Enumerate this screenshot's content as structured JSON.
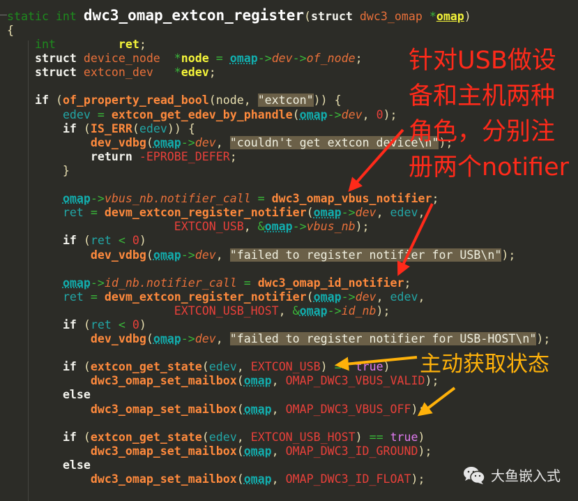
{
  "colors": {
    "background": "#2c2c27",
    "annotation_red": "#ff2a1a",
    "annotation_orange": "#ffb20a"
  },
  "code_lines": [
    [
      [
        "t",
        "static int "
      ],
      [
        "h",
        "dwc3_omap_extcon_register"
      ],
      [
        "p",
        "("
      ],
      [
        "k",
        "struct "
      ],
      [
        "s",
        "dwc3_omap "
      ],
      [
        "g",
        "*"
      ],
      [
        "vu",
        "omap"
      ],
      [
        "p",
        ")"
      ]
    ],
    [
      [
        "p",
        "{"
      ]
    ],
    [
      [
        "p",
        "    "
      ],
      [
        "t",
        "int"
      ],
      [
        "p",
        "         "
      ],
      [
        "v",
        "ret"
      ],
      [
        "p",
        ";"
      ]
    ],
    [
      [
        "p",
        "    "
      ],
      [
        "k",
        "struct "
      ],
      [
        "s",
        "device_node  "
      ],
      [
        "g",
        "*"
      ],
      [
        "v",
        "node"
      ],
      [
        "g",
        " = "
      ],
      [
        "o",
        "omap"
      ],
      [
        "g",
        "->"
      ],
      [
        "m",
        "dev"
      ],
      [
        "g",
        "->"
      ],
      [
        "m",
        "of_node"
      ],
      [
        "p",
        ";"
      ]
    ],
    [
      [
        "p",
        "    "
      ],
      [
        "k",
        "struct "
      ],
      [
        "s",
        "extcon_dev   "
      ],
      [
        "g",
        "*"
      ],
      [
        "v",
        "edev"
      ],
      [
        "p",
        ";"
      ]
    ],
    [],
    [
      [
        "p",
        "    "
      ],
      [
        "k",
        "if "
      ],
      [
        "p",
        "("
      ],
      [
        "f",
        "of_property_read_bool"
      ],
      [
        "p",
        "(node, "
      ],
      [
        "q",
        "\"extcon\""
      ],
      [
        "p",
        ")) {"
      ]
    ],
    [
      [
        "p",
        "        "
      ],
      [
        "r",
        "edev"
      ],
      [
        "g",
        " = "
      ],
      [
        "f",
        "extcon_get_edev_by_phandle"
      ],
      [
        "p",
        "("
      ],
      [
        "o",
        "omap"
      ],
      [
        "g",
        "->"
      ],
      [
        "m",
        "dev"
      ],
      [
        "p",
        ", "
      ],
      [
        "n",
        "0"
      ],
      [
        "p",
        ");"
      ]
    ],
    [
      [
        "p",
        "        "
      ],
      [
        "k",
        "if "
      ],
      [
        "p",
        "("
      ],
      [
        "f",
        "IS_ERR"
      ],
      [
        "p",
        "("
      ],
      [
        "r",
        "edev"
      ],
      [
        "p",
        ")) {"
      ]
    ],
    [
      [
        "p",
        "            "
      ],
      [
        "f",
        "dev_vdbg"
      ],
      [
        "p",
        "("
      ],
      [
        "o",
        "omap"
      ],
      [
        "g",
        "->"
      ],
      [
        "m",
        "dev"
      ],
      [
        "p",
        ", "
      ],
      [
        "q",
        "\"couldn't get extcon device\\n\""
      ],
      [
        "p",
        ");"
      ]
    ],
    [
      [
        "p",
        "            "
      ],
      [
        "k",
        "return "
      ],
      [
        "c",
        "-EPROBE_DEFER"
      ],
      [
        "p",
        ";"
      ]
    ],
    [
      [
        "p",
        "        }"
      ]
    ],
    [],
    [
      [
        "p",
        "        "
      ],
      [
        "o",
        "omap"
      ],
      [
        "g",
        "->"
      ],
      [
        "m",
        "vbus_nb.notifier_call"
      ],
      [
        "g",
        " = "
      ],
      [
        "f",
        "dwc3_omap_vbus_notifier"
      ],
      [
        "p",
        ";"
      ]
    ],
    [
      [
        "p",
        "        "
      ],
      [
        "r",
        "ret"
      ],
      [
        "g",
        " = "
      ],
      [
        "f",
        "devm_extcon_register_notifier"
      ],
      [
        "p",
        "("
      ],
      [
        "o",
        "omap"
      ],
      [
        "g",
        "->"
      ],
      [
        "m",
        "dev"
      ],
      [
        "p",
        ", "
      ],
      [
        "r",
        "edev"
      ],
      [
        "p",
        ","
      ]
    ],
    [
      [
        "p",
        "                        "
      ],
      [
        "c",
        "EXTCON_USB"
      ],
      [
        "p",
        ", "
      ],
      [
        "g",
        "&"
      ],
      [
        "o",
        "omap"
      ],
      [
        "g",
        "->"
      ],
      [
        "m",
        "vbus_nb"
      ],
      [
        "p",
        ");"
      ]
    ],
    [
      [
        "p",
        "        "
      ],
      [
        "k",
        "if "
      ],
      [
        "p",
        "("
      ],
      [
        "r",
        "ret"
      ],
      [
        "g",
        " < "
      ],
      [
        "n",
        "0"
      ],
      [
        "p",
        ")"
      ]
    ],
    [
      [
        "p",
        "            "
      ],
      [
        "f",
        "dev_vdbg"
      ],
      [
        "p",
        "("
      ],
      [
        "o",
        "omap"
      ],
      [
        "g",
        "->"
      ],
      [
        "m",
        "dev"
      ],
      [
        "p",
        ", "
      ],
      [
        "q",
        "\"failed to register notifier for USB\\n\""
      ],
      [
        "p",
        ");"
      ]
    ],
    [],
    [
      [
        "p",
        "        "
      ],
      [
        "o",
        "omap"
      ],
      [
        "g",
        "->"
      ],
      [
        "m",
        "id_nb.notifier_call"
      ],
      [
        "g",
        " = "
      ],
      [
        "f",
        "dwc3_omap_id_notifier"
      ],
      [
        "p",
        ";"
      ]
    ],
    [
      [
        "p",
        "        "
      ],
      [
        "r",
        "ret"
      ],
      [
        "g",
        " = "
      ],
      [
        "f",
        "devm_extcon_register_notifier"
      ],
      [
        "p",
        "("
      ],
      [
        "o",
        "omap"
      ],
      [
        "g",
        "->"
      ],
      [
        "m",
        "dev"
      ],
      [
        "p",
        ", "
      ],
      [
        "r",
        "edev"
      ],
      [
        "p",
        ","
      ]
    ],
    [
      [
        "p",
        "                        "
      ],
      [
        "c",
        "EXTCON_USB_HOST"
      ],
      [
        "p",
        ", "
      ],
      [
        "g",
        "&"
      ],
      [
        "o",
        "omap"
      ],
      [
        "g",
        "->"
      ],
      [
        "m",
        "id_nb"
      ],
      [
        "p",
        ");"
      ]
    ],
    [
      [
        "p",
        "        "
      ],
      [
        "k",
        "if "
      ],
      [
        "p",
        "("
      ],
      [
        "r",
        "ret"
      ],
      [
        "g",
        " < "
      ],
      [
        "n",
        "0"
      ],
      [
        "p",
        ")"
      ]
    ],
    [
      [
        "p",
        "            "
      ],
      [
        "f",
        "dev_vdbg"
      ],
      [
        "p",
        "("
      ],
      [
        "o",
        "omap"
      ],
      [
        "g",
        "->"
      ],
      [
        "m",
        "dev"
      ],
      [
        "p",
        ", "
      ],
      [
        "q",
        "\"failed to register notifier for USB-HOST\\n\""
      ],
      [
        "p",
        ");"
      ]
    ],
    [],
    [
      [
        "p",
        "        "
      ],
      [
        "k",
        "if "
      ],
      [
        "p",
        "("
      ],
      [
        "f",
        "extcon_get_state"
      ],
      [
        "p",
        "("
      ],
      [
        "r",
        "edev"
      ],
      [
        "p",
        ", "
      ],
      [
        "c",
        "EXTCON_USB"
      ],
      [
        "p",
        ") "
      ],
      [
        "g",
        "=="
      ],
      [
        "p",
        " "
      ],
      [
        "b",
        "true"
      ],
      [
        "p",
        ")"
      ]
    ],
    [
      [
        "p",
        "            "
      ],
      [
        "f",
        "dwc3_omap_set_mailbox"
      ],
      [
        "p",
        "("
      ],
      [
        "o",
        "omap"
      ],
      [
        "p",
        ", "
      ],
      [
        "c",
        "OMAP_DWC3_VBUS_VALID"
      ],
      [
        "p",
        ");"
      ]
    ],
    [
      [
        "p",
        "        "
      ],
      [
        "k",
        "else"
      ]
    ],
    [
      [
        "p",
        "            "
      ],
      [
        "f",
        "dwc3_omap_set_mailbox"
      ],
      [
        "p",
        "("
      ],
      [
        "o",
        "omap"
      ],
      [
        "p",
        ", "
      ],
      [
        "c",
        "OMAP_DWC3_VBUS_OFF"
      ],
      [
        "p",
        ");"
      ]
    ],
    [],
    [
      [
        "p",
        "        "
      ],
      [
        "k",
        "if "
      ],
      [
        "p",
        "("
      ],
      [
        "f",
        "extcon_get_state"
      ],
      [
        "p",
        "("
      ],
      [
        "r",
        "edev"
      ],
      [
        "p",
        ", "
      ],
      [
        "c",
        "EXTCON_USB_HOST"
      ],
      [
        "p",
        ") "
      ],
      [
        "g",
        "=="
      ],
      [
        "p",
        " "
      ],
      [
        "b",
        "true"
      ],
      [
        "p",
        ")"
      ]
    ],
    [
      [
        "p",
        "            "
      ],
      [
        "f",
        "dwc3_omap_set_mailbox"
      ],
      [
        "p",
        "("
      ],
      [
        "o",
        "omap"
      ],
      [
        "p",
        ", "
      ],
      [
        "c",
        "OMAP_DWC3_ID_GROUND"
      ],
      [
        "p",
        ");"
      ]
    ],
    [
      [
        "p",
        "        "
      ],
      [
        "k",
        "else"
      ]
    ],
    [
      [
        "p",
        "            "
      ],
      [
        "f",
        "dwc3_omap_set_mailbox"
      ],
      [
        "p",
        "("
      ],
      [
        "o",
        "omap"
      ],
      [
        "p",
        ", "
      ],
      [
        "c",
        "OMAP_DWC3_ID_FLOAT"
      ],
      [
        "p",
        ");"
      ]
    ]
  ],
  "annotations": {
    "red_note": "针对USB做设\n备和主机两种\n角色，分别注\n册两个notifier",
    "orange_note": "主动获取状态"
  },
  "watermark": {
    "icon": "wechat-icon",
    "text": "大鱼嵌入式"
  }
}
